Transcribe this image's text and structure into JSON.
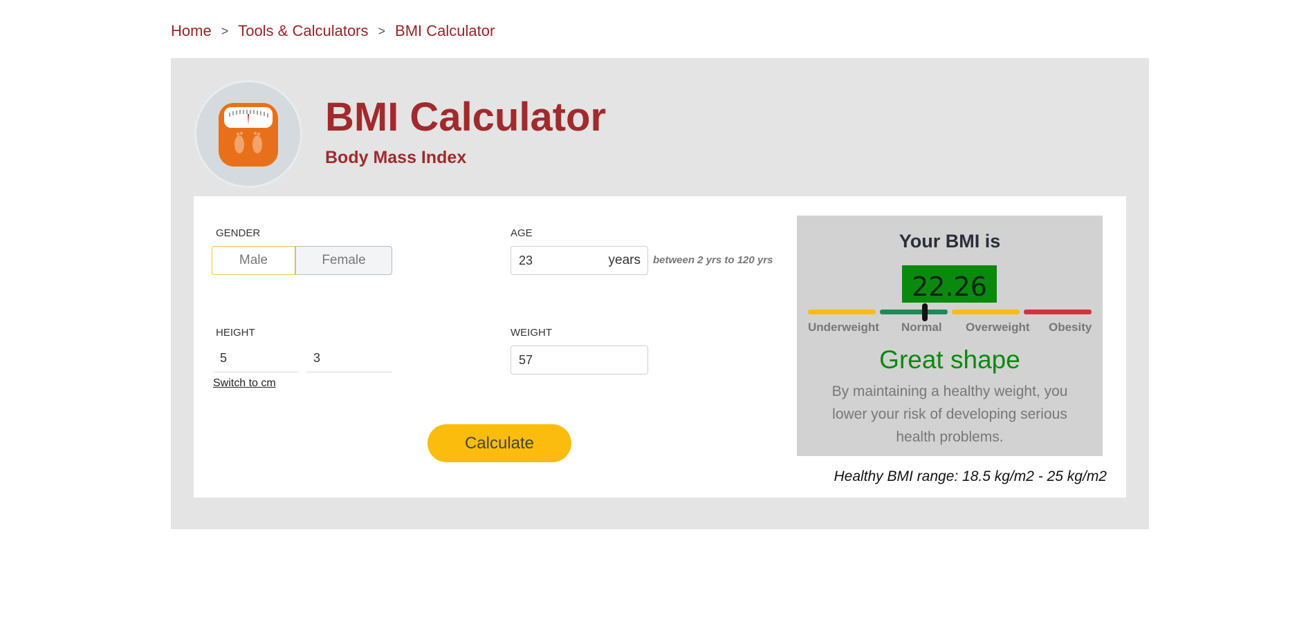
{
  "breadcrumb": {
    "items": [
      "Home",
      "Tools & Calculators",
      "BMI Calculator"
    ],
    "separator": ">"
  },
  "header": {
    "title": "BMI Calculator",
    "subtitle": "Body Mass Index",
    "logo_icon": "bathroom-scale-icon"
  },
  "form": {
    "gender": {
      "label": "GENDER",
      "options": [
        "Male",
        "Female"
      ],
      "selected": "Male"
    },
    "age": {
      "label": "AGE",
      "value": "23",
      "unit": "years",
      "hint": "between 2 yrs to 120 yrs"
    },
    "height": {
      "label": "HEIGHT",
      "feet": "5",
      "inches": "3",
      "switch_link": "Switch to cm"
    },
    "weight": {
      "label": "WEIGHT",
      "value": "57"
    },
    "calculate_label": "Calculate"
  },
  "result": {
    "title": "Your BMI is",
    "value": "22.26",
    "categories": [
      "Underweight",
      "Normal",
      "Overweight",
      "Obesity"
    ],
    "status": "Great shape",
    "description": "By maintaining a healthy weight, you lower your risk of developing serious health problems.",
    "healthy_range": "Healthy BMI range: 18.5 kg/m2 - 25 kg/m2"
  },
  "colors": {
    "brand": "#a12a2d",
    "accent": "#fbbc0d",
    "healthy": "#098a0d",
    "scale": [
      "#fbbc0d",
      "#1e8a55",
      "#fbbc0d",
      "#d9303d"
    ]
  }
}
